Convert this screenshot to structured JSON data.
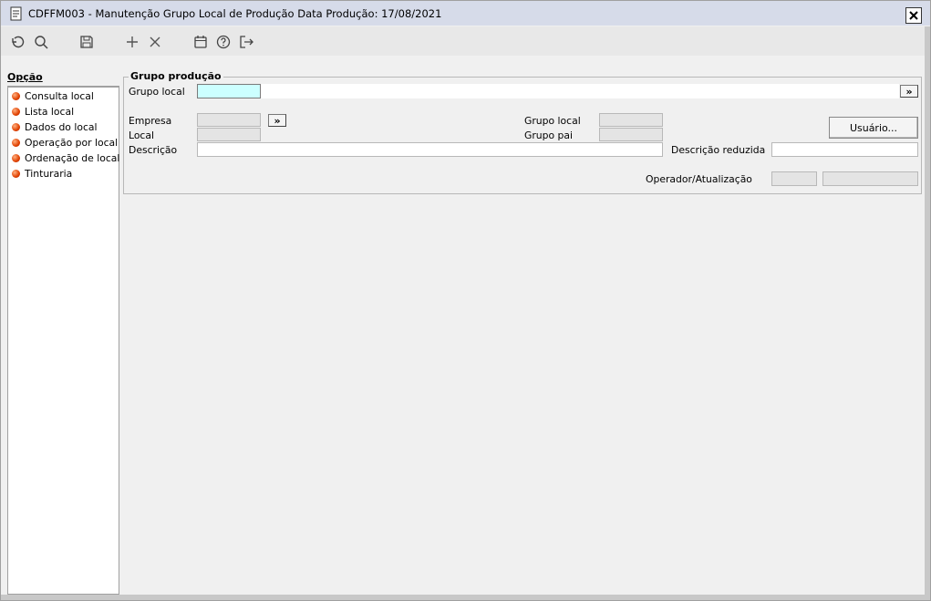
{
  "window": {
    "title": "CDFFM003 - Manutenção Grupo Local de Produção Data Produção: 17/08/2021",
    "close_label": "✕"
  },
  "toolbar": {
    "icons": [
      "undo-icon",
      "search-icon",
      "save-icon",
      "plus-icon",
      "close-icon",
      "calendar-icon",
      "help-icon",
      "exit-icon"
    ]
  },
  "sidebar": {
    "title": "Opção",
    "items": [
      {
        "label": "Consulta local"
      },
      {
        "label": "Lista local"
      },
      {
        "label": "Dados do local"
      },
      {
        "label": "Operação por local"
      },
      {
        "label": "Ordenação de local"
      },
      {
        "label": "Tinturaria"
      }
    ]
  },
  "form": {
    "group_title": "Grupo produção",
    "grupo_local_label": "Grupo local",
    "grupo_local_value": "",
    "more_label": "»",
    "empresa_label": "Empresa",
    "empresa_value": "",
    "local_label": "Local",
    "local_value": "",
    "grupo_local2_label": "Grupo local",
    "grupo_local2_value": "",
    "grupo_pai_label": "Grupo pai",
    "grupo_pai_value": "",
    "usuario_button": "Usuário...",
    "descricao_label": "Descrição",
    "descricao_value": "",
    "descricao_reduzida_label": "Descrição reduzida",
    "descricao_reduzida_value": "",
    "operador_label": "Operador/Atualização",
    "operador_value": "",
    "atualizacao_value": ""
  },
  "colors": {
    "titlebar": "#d6dbe9",
    "active_field": "#ccffff",
    "bullet": "#e04000"
  }
}
